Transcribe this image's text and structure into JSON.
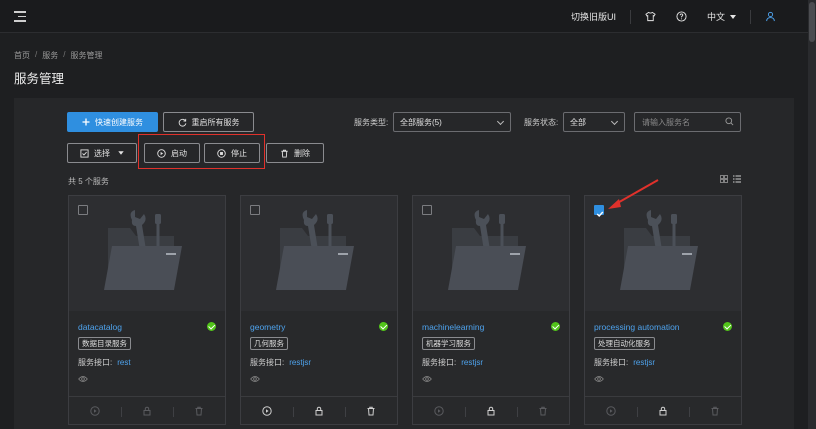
{
  "topbar": {
    "switch_ui": "切换旧版UI",
    "language": "中文"
  },
  "breadcrumb": [
    "首页",
    "服务",
    "服务管理"
  ],
  "page_title": "服务管理",
  "toolbar": {
    "quick_create": "快速创建服务",
    "restart_all": "重启所有服务",
    "select": "选择",
    "start": "启动",
    "stop": "停止",
    "delete": "删除",
    "service_type_label": "服务类型:",
    "service_type_value": "全部服务(5)",
    "service_status_label": "服务状态:",
    "service_status_value": "全部",
    "search_placeholder": "请输入服务名"
  },
  "count_text": "共 5 个服务",
  "interface_label": "服务接口:",
  "services": [
    {
      "name": "datacatalog",
      "tag": "数据目录服务",
      "interface": "rest",
      "checked": false
    },
    {
      "name": "geometry",
      "tag": "几何服务",
      "interface": "restjsr",
      "checked": false
    },
    {
      "name": "machinelearning",
      "tag": "机器学习服务",
      "interface": "restjsr",
      "checked": false
    },
    {
      "name": "processing automation",
      "tag": "处理自动化服务",
      "interface": "restjsr",
      "checked": true
    }
  ],
  "colors": {
    "accent": "#2f8fe0",
    "status_ok": "#52c41a",
    "highlight": "#e0312b"
  }
}
